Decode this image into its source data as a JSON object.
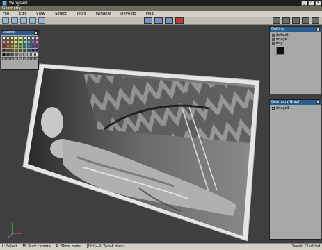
{
  "window": {
    "title": "Wings3D",
    "buttons": [
      "_",
      "▫",
      "×"
    ]
  },
  "geometry_tab": "Geometry",
  "menu": [
    "File",
    "Edit",
    "View",
    "Select",
    "Tools",
    "Window",
    "Develop",
    "Help"
  ],
  "toolbar": {
    "selection_mode_colors": [
      "#7b8fbf",
      "#7b8fbf",
      "#7b8fbf",
      "#c23b3b"
    ]
  },
  "palette": {
    "title": "Palette",
    "colors": [
      "#ffffff",
      "#f0e0a0",
      "#ffe680",
      "#ffff99",
      "#e0ff99",
      "#b3ffcc",
      "#b3e6ff",
      "#ccccff",
      "#ffcce6",
      "#ff8080",
      "#ffa64d",
      "#ffcc00",
      "#ffff00",
      "#99ff33",
      "#33ff99",
      "#33ccff",
      "#6666ff",
      "#ff66cc",
      "#cc0000",
      "#cc6600",
      "#cc9900",
      "#cccc00",
      "#669900",
      "#009966",
      "#0099cc",
      "#3333cc",
      "#990099",
      "#660000",
      "#663300",
      "#664d00",
      "#666600",
      "#336600",
      "#006633",
      "#004d66",
      "#1a1a66",
      "#4d004d",
      "#000000",
      "#333333",
      "#4d4d4d",
      "#666666",
      "#808080",
      "#999999",
      "#b3b3b3",
      "#cccccc",
      "#e6e6e6",
      "#8a8a8a",
      "#8a8a8a",
      "#8a8a8a",
      "#8a8a8a",
      "#8a8a8a",
      "#8a8a8a",
      "#8a8a8a",
      "#8a8a8a",
      "#8a8a8a"
    ]
  },
  "outliner": {
    "title": "Outliner",
    "items": [
      "default",
      "image",
      "Img"
    ]
  },
  "geometry_graph": {
    "title": "Geometry Graph",
    "items": [
      "image1"
    ]
  },
  "status": {
    "items": [
      "L: Select",
      "M: Start camera",
      "R: Show menu",
      "[Ctrl]+R: Tweak menu"
    ],
    "right": "Tweak: Disabled"
  }
}
